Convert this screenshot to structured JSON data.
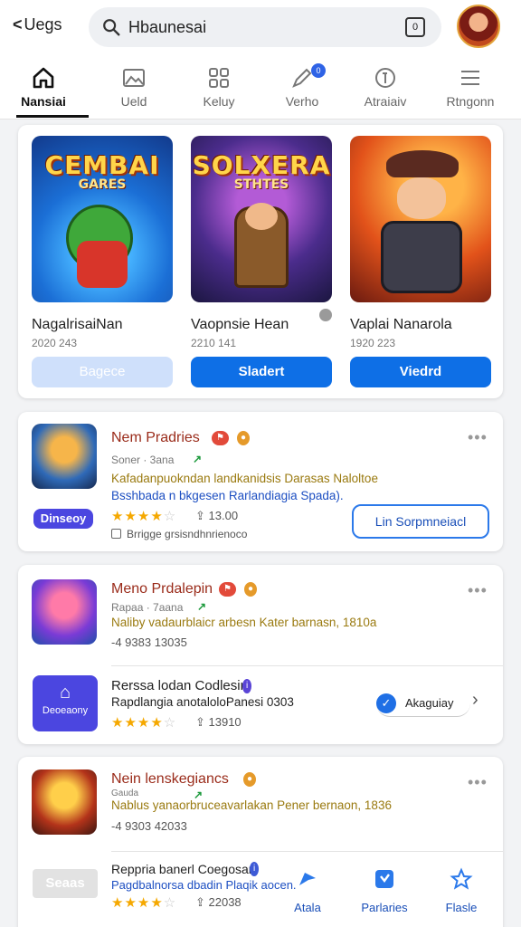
{
  "header": {
    "back_label": "Uegs",
    "search_value": "Hbaunesai",
    "search_box_glyph": "0"
  },
  "nav": {
    "tabs": [
      {
        "label": "Nansiai",
        "icon": "home-icon",
        "active": true
      },
      {
        "label": "Ueld",
        "icon": "image-icon",
        "active": false
      },
      {
        "label": "Keluy",
        "icon": "apps-grid-icon",
        "active": false
      },
      {
        "label": "Verho",
        "icon": "pen-icon",
        "active": false,
        "badge": "0"
      },
      {
        "label": "Atraiaiv",
        "icon": "compass-icon",
        "active": false
      },
      {
        "label": "Rtngonn",
        "icon": "menu-icon",
        "active": false
      }
    ]
  },
  "featured": {
    "items": [
      {
        "art_title": "CEMBAI",
        "art_subtitle": "GARES",
        "name": "NagalrisaiNan",
        "date": "2020 243",
        "button": "Bagece",
        "enabled": false
      },
      {
        "art_title": "SOLXERA",
        "art_subtitle": "STHTES",
        "name": "Vaopnsie Hean",
        "date": "2210 141",
        "button": "Sladert",
        "enabled": true
      },
      {
        "art_title": "",
        "art_subtitle": "",
        "name": "Vaplai Nanarola",
        "date": "1920 223",
        "button": "Viedrd",
        "enabled": true
      }
    ]
  },
  "list": [
    {
      "title": "Nem Pradries",
      "meta": "Soner · 3ana",
      "desc1": "Kafadanpuokndan landkanidsis Darasas Naloltoe",
      "desc2": "Bsshbada n bkgesen Rarlandiagia Spada).",
      "badge": "Dinseoy",
      "rating": 3.5,
      "count": "13.00",
      "checkbox_text": "Brrigge grsisndhnrienoco",
      "action": "Lin Sorpmneiacl"
    },
    {
      "title": "Meno Prdalepin",
      "meta": "Rapaa · 7aana",
      "desc1": "Naliby vadaurblaicr arbesn Kater barnasn, 1810a",
      "count_line": "-4 9383 13035",
      "sub_title": "Rerssa lodan Codlesin",
      "sub_desc": "Rapdlangia anotaloloPanesi 0303",
      "sub_badge": "Deoeaony",
      "sub_rating": 3.5,
      "sub_count": "13910",
      "sub_action": "Akaguiay"
    },
    {
      "title": "Nein lenskegiancs",
      "meta": "Gauda",
      "desc1": "Nablus yanaorbruceavarlakan Pener bernaon, 1836",
      "count_line": "-4 9303 42033",
      "sub_title": "Reppria banerl Coegosan",
      "sub_desc": "Pagdbalnorsa dbadin Plaqik aocen.",
      "sub_badge": "Seaas",
      "sub_rating": 4,
      "sub_count": "22038",
      "actions": [
        {
          "label": "Atala",
          "icon": "share-icon"
        },
        {
          "label": "Parlaries",
          "icon": "bookmark-icon"
        },
        {
          "label": "Flasle",
          "icon": "star-outline-icon"
        }
      ]
    }
  ],
  "colors": {
    "accent": "#0e6fe6",
    "badge_purple": "#4b46e0",
    "title_red": "#9a2b1a"
  }
}
